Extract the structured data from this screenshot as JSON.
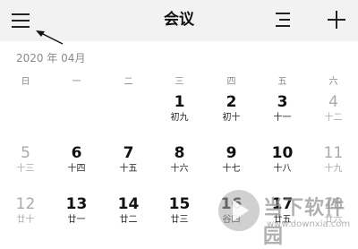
{
  "header": {
    "title": "会议",
    "menu_icon": "hamburger-menu-icon",
    "list_icon": "list-icon",
    "add_icon": "plus-icon"
  },
  "month_label": "2020 年 04月",
  "weekdays": [
    "日",
    "一",
    "二",
    "三",
    "四",
    "五",
    "六"
  ],
  "weeks": [
    [
      null,
      null,
      null,
      {
        "day": "1",
        "lunar": "初九",
        "muted": false
      },
      {
        "day": "2",
        "lunar": "初十",
        "muted": false
      },
      {
        "day": "3",
        "lunar": "十一",
        "muted": false
      },
      {
        "day": "4",
        "lunar": "十二",
        "muted": true
      }
    ],
    [
      {
        "day": "5",
        "lunar": "十三",
        "muted": true
      },
      {
        "day": "6",
        "lunar": "十四",
        "muted": false
      },
      {
        "day": "7",
        "lunar": "十五",
        "muted": false
      },
      {
        "day": "8",
        "lunar": "十六",
        "muted": false
      },
      {
        "day": "9",
        "lunar": "十七",
        "muted": false
      },
      {
        "day": "10",
        "lunar": "十八",
        "muted": false
      },
      {
        "day": "11",
        "lunar": "十九",
        "muted": true
      }
    ],
    [
      {
        "day": "12",
        "lunar": "廿十",
        "muted": true
      },
      {
        "day": "13",
        "lunar": "廿一",
        "muted": false
      },
      {
        "day": "14",
        "lunar": "廿二",
        "muted": false
      },
      {
        "day": "15",
        "lunar": "廿三",
        "muted": false
      },
      {
        "day": "16",
        "lunar": "谷四",
        "muted": false
      },
      {
        "day": "17",
        "lunar": "廿五",
        "muted": false
      },
      {
        "day": "18",
        "lunar": "廿六",
        "muted": true
      }
    ]
  ],
  "watermark": {
    "text": "当下软件园",
    "url": "www.downxia.com",
    "logo_icon": "play-logo-icon"
  },
  "colors": {
    "header_bg": "#f2f2f2",
    "muted": "#aaaaaa",
    "text": "#111111"
  }
}
